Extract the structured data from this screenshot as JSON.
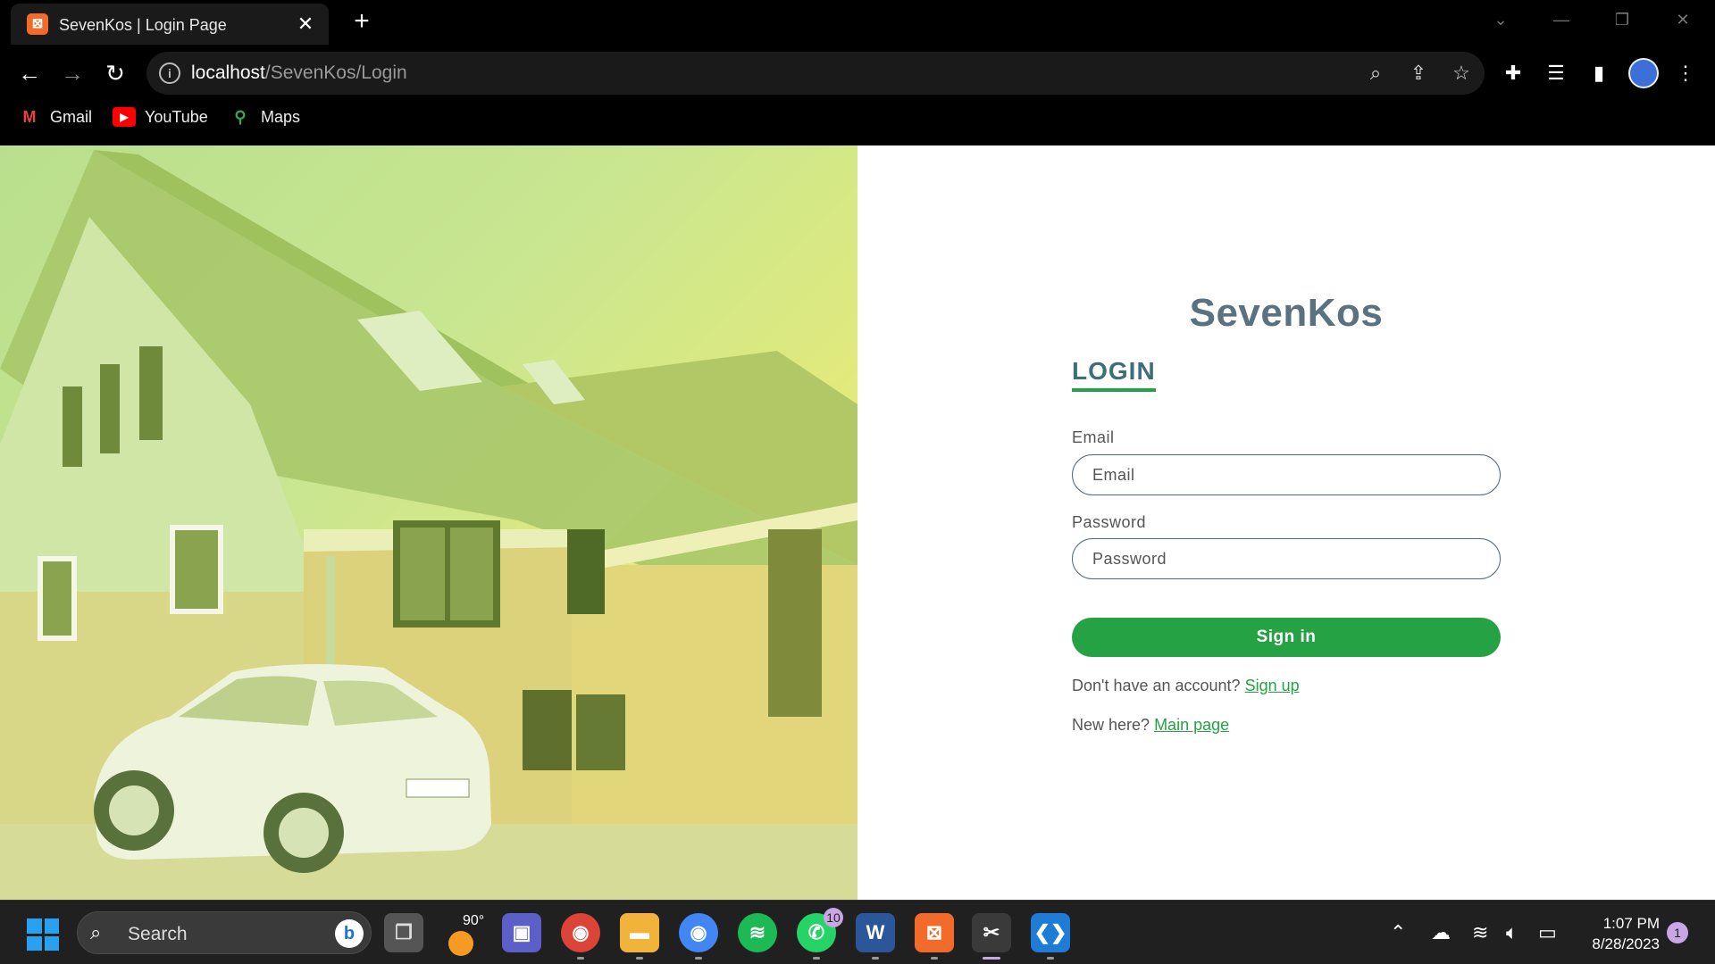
{
  "browser": {
    "tab": {
      "title": "SevenKos | Login Page",
      "favicon": "xampp-icon"
    },
    "url": {
      "host": "localhost",
      "path": "/SevenKos/Login"
    },
    "bookmarks": [
      {
        "label": "Gmail",
        "icon": "gmail-icon",
        "color": "#ea4335"
      },
      {
        "label": "YouTube",
        "icon": "youtube-icon",
        "color": "#ff0000"
      },
      {
        "label": "Maps",
        "icon": "maps-icon",
        "color": "#34a853"
      }
    ]
  },
  "page": {
    "brand": "SevenKos",
    "login_title": "LOGIN",
    "email": {
      "label": "Email",
      "placeholder": "Email"
    },
    "password": {
      "label": "Password",
      "placeholder": "Password"
    },
    "signin_label": "Sign in",
    "signup_prompt": "Don't have an account?",
    "signup_link": "Sign up",
    "main_prompt": "New here?",
    "main_link": "Main page",
    "accent_color": "#25a244"
  },
  "taskbar": {
    "search_label": "Search",
    "weather_temp": "90°",
    "whatsapp_badge": "10",
    "time": "1:07 PM",
    "date": "8/28/2023",
    "notification_count": "1"
  }
}
